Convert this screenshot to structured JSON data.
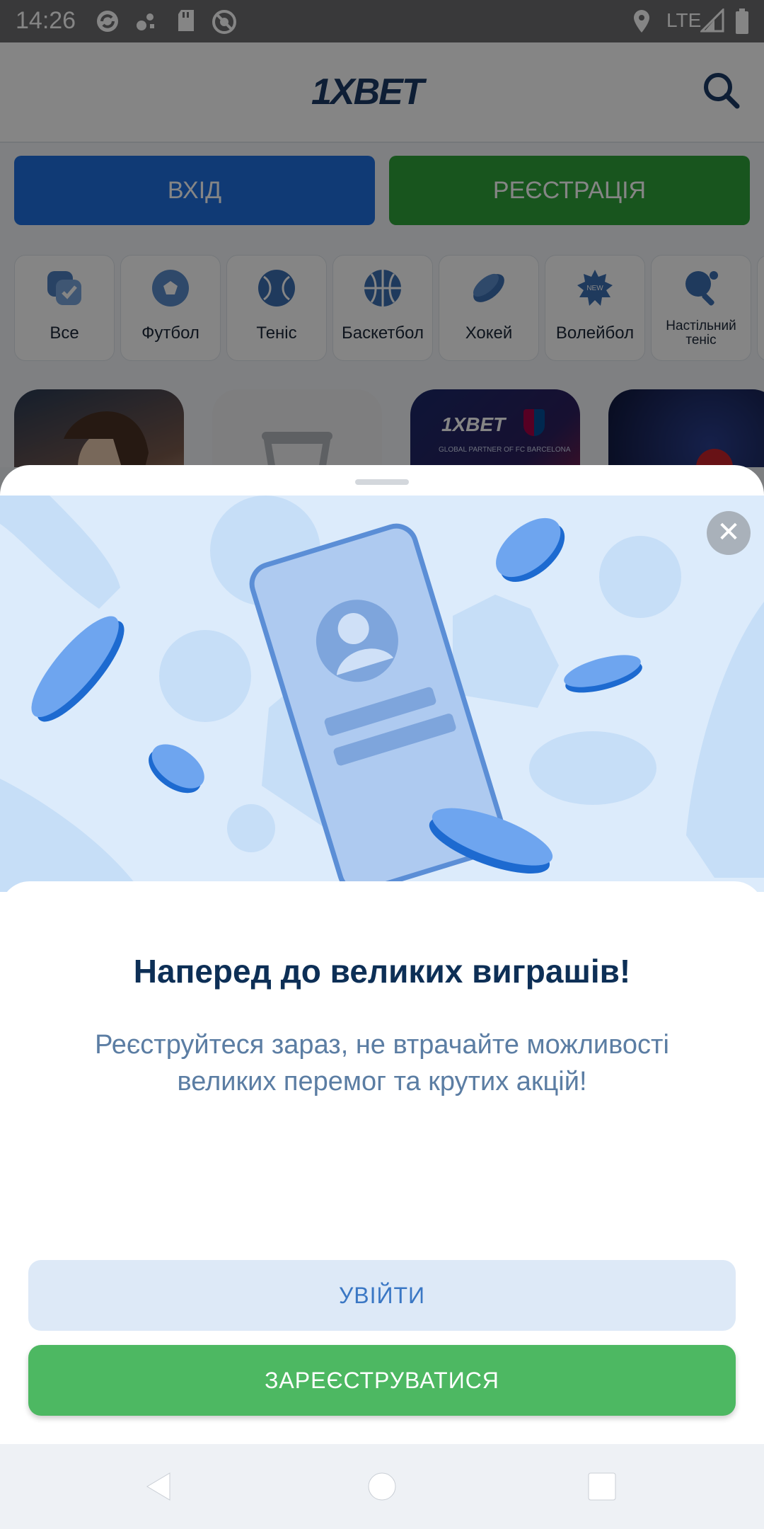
{
  "status_bar": {
    "time": "14:26",
    "network": "LTE",
    "left_icons": [
      "sync-icon",
      "satellite-icon",
      "sd-card-icon",
      "do-not-disturb-icon"
    ],
    "right_icons": [
      "location-icon",
      "signal-icon",
      "battery-icon"
    ]
  },
  "header": {
    "logo": "1XBET"
  },
  "auth": {
    "login_label": "ВХІД",
    "register_label": "РЕЄСТРАЦІЯ"
  },
  "sports": [
    {
      "label": "Все",
      "icon": "all-icon"
    },
    {
      "label": "Футбол",
      "icon": "football-icon"
    },
    {
      "label": "Теніс",
      "icon": "tennis-icon"
    },
    {
      "label": "Баскетбол",
      "icon": "basketball-icon"
    },
    {
      "label": "Хокей",
      "icon": "hockey-icon"
    },
    {
      "label": "Волейбол",
      "icon": "volleyball-icon",
      "badge": "NEW"
    },
    {
      "label": "Настільний теніс",
      "icon": "table-tennis-icon"
    }
  ],
  "banners": {
    "partner_text": "GLOBAL PARTNER OF FC BARCELONA",
    "partner_logo": "1XBET"
  },
  "sheet": {
    "title": "Наперед до великих виграшів!",
    "text": "Реєструйтеся зараз, не втрачайте можливості великих перемог та крутих акцій!",
    "login_button": "УВІЙТИ",
    "register_button": "ЗАРЕЄСТРУВАТИСЯ"
  },
  "colors": {
    "accent_blue": "#1f6fe0",
    "accent_green": "#4db862",
    "title_navy": "#0d2f56"
  }
}
